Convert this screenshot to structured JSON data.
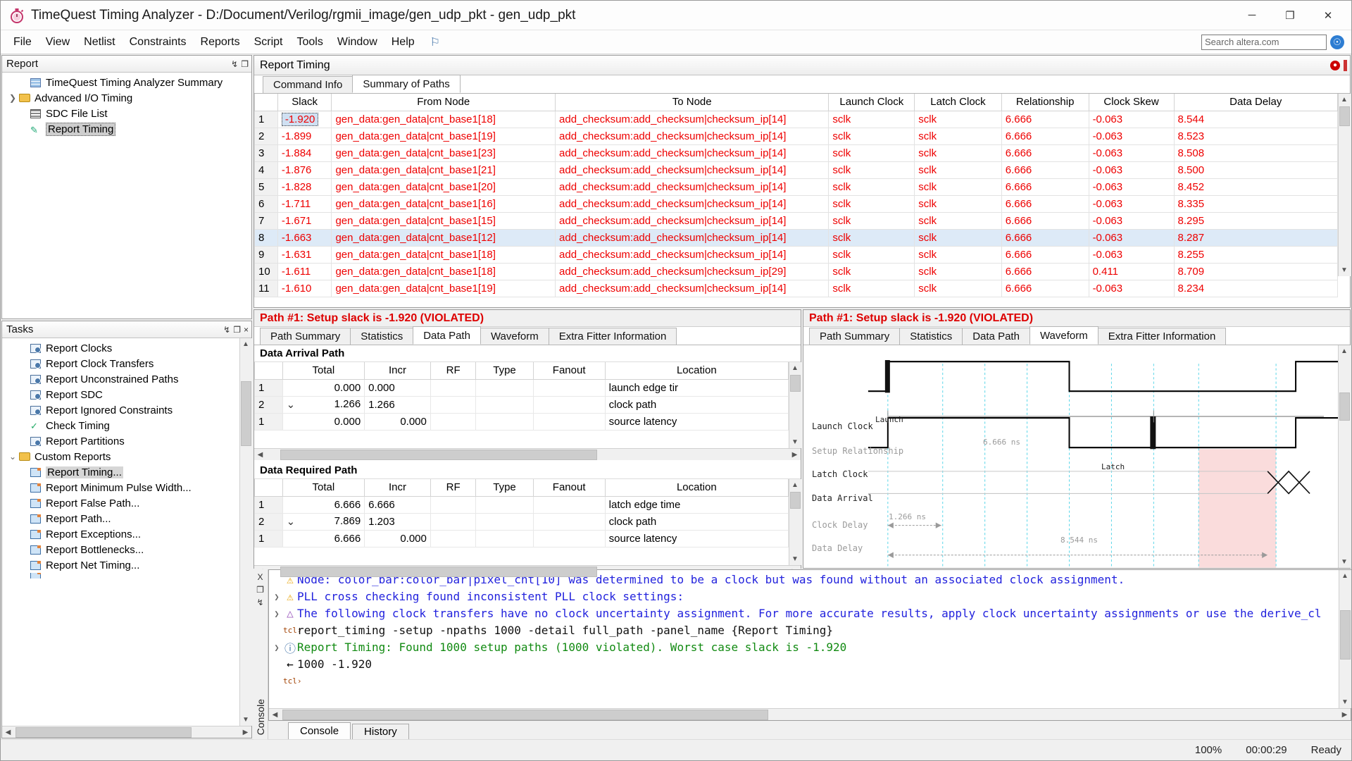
{
  "window": {
    "title": "TimeQuest Timing Analyzer - D:/Document/Verilog/rgmii_image/gen_udp_pkt - gen_udp_pkt",
    "app_icon": "stopwatch-icon",
    "minimize": "─",
    "maximize": "❐",
    "close": "✕"
  },
  "menubar": {
    "items": [
      "File",
      "View",
      "Netlist",
      "Constraints",
      "Reports",
      "Script",
      "Tools",
      "Window",
      "Help"
    ],
    "flag_icon": "flag-icon",
    "search_placeholder": "Search altera.com",
    "globe_icon": "globe-icon"
  },
  "report_panel": {
    "title": "Report",
    "pin": "↯",
    "float": "❐",
    "close": "×",
    "items": [
      {
        "label": "TimeQuest Timing Analyzer Summary",
        "icon": "table-icon",
        "twist": "",
        "indent": 1,
        "selected": false
      },
      {
        "label": "Advanced I/O Timing",
        "icon": "folder-icon",
        "twist": "❯",
        "indent": 0,
        "selected": false
      },
      {
        "label": "SDC File List",
        "icon": "table-icon",
        "twist": "",
        "indent": 1,
        "selected": false
      },
      {
        "label": "Report Timing",
        "icon": "pen-icon",
        "twist": "",
        "indent": 1,
        "selected": true
      }
    ]
  },
  "tasks_panel": {
    "title": "Tasks",
    "pin": "↯",
    "float": "❐",
    "close": "×",
    "items": [
      {
        "label": "Report Clocks",
        "icon": "report-icon",
        "twist": "",
        "indent": 1,
        "selected": false
      },
      {
        "label": "Report Clock Transfers",
        "icon": "report-icon",
        "twist": "",
        "indent": 1,
        "selected": false
      },
      {
        "label": "Report Unconstrained Paths",
        "icon": "report-icon",
        "twist": "",
        "indent": 1,
        "selected": false
      },
      {
        "label": "Report SDC",
        "icon": "report-icon",
        "twist": "",
        "indent": 1,
        "selected": false
      },
      {
        "label": "Report Ignored Constraints",
        "icon": "report-icon",
        "twist": "",
        "indent": 1,
        "selected": false
      },
      {
        "label": "Check Timing",
        "icon": "check-icon",
        "twist": "",
        "indent": 1,
        "selected": false
      },
      {
        "label": "Report Partitions",
        "icon": "report-icon",
        "twist": "",
        "indent": 1,
        "selected": false
      },
      {
        "label": "Custom Reports",
        "icon": "folder-open-icon",
        "twist": "⌄",
        "indent": 0,
        "selected": false
      },
      {
        "label": "Report Timing...",
        "icon": "window-icon",
        "twist": "",
        "indent": 2,
        "selected": true
      },
      {
        "label": "Report Minimum Pulse Width...",
        "icon": "window-icon",
        "twist": "",
        "indent": 2,
        "selected": false
      },
      {
        "label": "Report False Path...",
        "icon": "window-icon",
        "twist": "",
        "indent": 2,
        "selected": false
      },
      {
        "label": "Report Path...",
        "icon": "window-icon",
        "twist": "",
        "indent": 2,
        "selected": false
      },
      {
        "label": "Report Exceptions...",
        "icon": "window-icon",
        "twist": "",
        "indent": 2,
        "selected": false
      },
      {
        "label": "Report Bottlenecks...",
        "icon": "window-icon",
        "twist": "",
        "indent": 2,
        "selected": false
      },
      {
        "label": "Report Net Timing...",
        "icon": "window-icon",
        "twist": "",
        "indent": 2,
        "selected": false
      }
    ]
  },
  "report_timing": {
    "title": "Report Timing",
    "tabs": [
      {
        "label": "Command Info",
        "active": false
      },
      {
        "label": "Summary of Paths",
        "active": true
      }
    ],
    "columns": [
      "",
      "Slack",
      "From Node",
      "To Node",
      "Launch Clock",
      "Latch Clock",
      "Relationship",
      "Clock Skew",
      "Data Delay"
    ],
    "rows": [
      {
        "idx": "1",
        "slack": "-1.920",
        "from": "gen_data:gen_data|cnt_base1[18]",
        "to": "add_checksum:add_checksum|checksum_ip[14]",
        "launch": "sclk",
        "latch": "sclk",
        "rel": "6.666",
        "skew": "-0.063",
        "delay": "8.544",
        "selected": true,
        "highlight": false
      },
      {
        "idx": "2",
        "slack": "-1.899",
        "from": "gen_data:gen_data|cnt_base1[19]",
        "to": "add_checksum:add_checksum|checksum_ip[14]",
        "launch": "sclk",
        "latch": "sclk",
        "rel": "6.666",
        "skew": "-0.063",
        "delay": "8.523",
        "selected": false,
        "highlight": false
      },
      {
        "idx": "3",
        "slack": "-1.884",
        "from": "gen_data:gen_data|cnt_base1[23]",
        "to": "add_checksum:add_checksum|checksum_ip[14]",
        "launch": "sclk",
        "latch": "sclk",
        "rel": "6.666",
        "skew": "-0.063",
        "delay": "8.508",
        "selected": false,
        "highlight": false
      },
      {
        "idx": "4",
        "slack": "-1.876",
        "from": "gen_data:gen_data|cnt_base1[21]",
        "to": "add_checksum:add_checksum|checksum_ip[14]",
        "launch": "sclk",
        "latch": "sclk",
        "rel": "6.666",
        "skew": "-0.063",
        "delay": "8.500",
        "selected": false,
        "highlight": false
      },
      {
        "idx": "5",
        "slack": "-1.828",
        "from": "gen_data:gen_data|cnt_base1[20]",
        "to": "add_checksum:add_checksum|checksum_ip[14]",
        "launch": "sclk",
        "latch": "sclk",
        "rel": "6.666",
        "skew": "-0.063",
        "delay": "8.452",
        "selected": false,
        "highlight": false
      },
      {
        "idx": "6",
        "slack": "-1.711",
        "from": "gen_data:gen_data|cnt_base1[16]",
        "to": "add_checksum:add_checksum|checksum_ip[14]",
        "launch": "sclk",
        "latch": "sclk",
        "rel": "6.666",
        "skew": "-0.063",
        "delay": "8.335",
        "selected": false,
        "highlight": false
      },
      {
        "idx": "7",
        "slack": "-1.671",
        "from": "gen_data:gen_data|cnt_base1[15]",
        "to": "add_checksum:add_checksum|checksum_ip[14]",
        "launch": "sclk",
        "latch": "sclk",
        "rel": "6.666",
        "skew": "-0.063",
        "delay": "8.295",
        "selected": false,
        "highlight": false
      },
      {
        "idx": "8",
        "slack": "-1.663",
        "from": "gen_data:gen_data|cnt_base1[12]",
        "to": "add_checksum:add_checksum|checksum_ip[14]",
        "launch": "sclk",
        "latch": "sclk",
        "rel": "6.666",
        "skew": "-0.063",
        "delay": "8.287",
        "selected": false,
        "highlight": true
      },
      {
        "idx": "9",
        "slack": "-1.631",
        "from": "gen_data:gen_data|cnt_base1[18]",
        "to": "add_checksum:add_checksum|checksum_ip[14]",
        "launch": "sclk",
        "latch": "sclk",
        "rel": "6.666",
        "skew": "-0.063",
        "delay": "8.255",
        "selected": false,
        "highlight": false
      },
      {
        "idx": "10",
        "slack": "-1.611",
        "from": "gen_data:gen_data|cnt_base1[18]",
        "to": "add_checksum:add_checksum|checksum_ip[29]",
        "launch": "sclk",
        "latch": "sclk",
        "rel": "6.666",
        "skew": "0.411",
        "delay": "8.709",
        "selected": false,
        "highlight": false
      },
      {
        "idx": "11",
        "slack": "-1.610",
        "from": "gen_data:gen_data|cnt_base1[19]",
        "to": "add_checksum:add_checksum|checksum_ip[14]",
        "launch": "sclk",
        "latch": "sclk",
        "rel": "6.666",
        "skew": "-0.063",
        "delay": "8.234",
        "selected": false,
        "highlight": false
      }
    ]
  },
  "left_path_panel": {
    "title": "Path #1: Setup slack is -1.920 (VIOLATED)",
    "tabs": [
      {
        "label": "Path Summary",
        "active": false
      },
      {
        "label": "Statistics",
        "active": false
      },
      {
        "label": "Data Path",
        "active": true
      },
      {
        "label": "Waveform",
        "active": false
      },
      {
        "label": "Extra Fitter Information",
        "active": false
      }
    ],
    "arrival": {
      "section": "Data Arrival Path",
      "columns": [
        "",
        "Total",
        "Incr",
        "RF",
        "Type",
        "Fanout",
        "Location"
      ],
      "rows": [
        {
          "idx": "1",
          "total": "0.000",
          "incr": "0.000",
          "rf": "",
          "type": "",
          "fanout": "",
          "location": "launch edge tir",
          "twist": false,
          "indent": 0
        },
        {
          "idx": "2",
          "total": "1.266",
          "incr": "1.266",
          "rf": "",
          "type": "",
          "fanout": "",
          "location": "clock path",
          "twist": true,
          "indent": 0
        },
        {
          "idx": "1",
          "total": "0.000",
          "incr": "0.000",
          "rf": "",
          "type": "",
          "fanout": "",
          "location": "source latency",
          "twist": false,
          "indent": 1
        }
      ]
    },
    "required": {
      "section": "Data Required Path",
      "columns": [
        "",
        "Total",
        "Incr",
        "RF",
        "Type",
        "Fanout",
        "Location"
      ],
      "rows": [
        {
          "idx": "1",
          "total": "6.666",
          "incr": "6.666",
          "rf": "",
          "type": "",
          "fanout": "",
          "location": "latch edge time",
          "twist": false,
          "indent": 0
        },
        {
          "idx": "2",
          "total": "7.869",
          "incr": "1.203",
          "rf": "",
          "type": "",
          "fanout": "",
          "location": "clock path",
          "twist": true,
          "indent": 0
        },
        {
          "idx": "1",
          "total": "6.666",
          "incr": "0.000",
          "rf": "",
          "type": "",
          "fanout": "",
          "location": "source latency",
          "twist": false,
          "indent": 1
        }
      ]
    }
  },
  "right_path_panel": {
    "title": "Path #1: Setup slack is -1.920 (VIOLATED)",
    "tabs": [
      {
        "label": "Path Summary",
        "active": false
      },
      {
        "label": "Statistics",
        "active": false
      },
      {
        "label": "Data Path",
        "active": false
      },
      {
        "label": "Waveform",
        "active": true
      },
      {
        "label": "Extra Fitter Information",
        "active": false
      }
    ],
    "waveform": {
      "rows": [
        "Launch Clock",
        "Setup Relationship",
        "Latch Clock",
        "Data Arrival",
        "Clock Delay",
        "Data Delay"
      ],
      "markers": {
        "launch": "Launch",
        "latch": "Latch",
        "setup_relationship_value": "6.666 ns",
        "clock_delay_value": "1.266 ns",
        "data_delay_value": "8.544 ns"
      }
    }
  },
  "console": {
    "lines": [
      {
        "twist": "",
        "icon": "warning-icon",
        "icon_kind": "warn",
        "text": "Node: color_bar:color_bar|pixel_cnt[10] was determined to be a clock but was found without an associated clock assignment.",
        "color": "blue"
      },
      {
        "twist": "❯",
        "icon": "warning-icon",
        "icon_kind": "warn",
        "text": "PLL cross checking found inconsistent PLL clock settings:",
        "color": "blue"
      },
      {
        "twist": "❯",
        "icon": "warning-icon",
        "icon_kind": "warn2",
        "text": "The following clock transfers have no clock uncertainty assignment. For more accurate results, apply clock uncertainty assignments or use the derive_cl",
        "color": "blue"
      },
      {
        "twist": "",
        "icon": "tcl-icon",
        "icon_kind": "tcl",
        "text": "report_timing -setup -npaths 1000 -detail full_path -panel_name {Report Timing}",
        "color": "black"
      },
      {
        "twist": "❯",
        "icon": "info-icon",
        "icon_kind": "info",
        "text": "Report Timing: Found 1000 setup paths (1000 violated).  Worst case slack is -1.920",
        "color": "green"
      },
      {
        "twist": "",
        "icon": "return-icon",
        "icon_kind": "plain",
        "text": "1000 -1.920",
        "color": "black"
      },
      {
        "twist": "",
        "icon": "tcl-icon",
        "icon_kind": "tcl",
        "text": "",
        "color": "black"
      }
    ],
    "side_close": "X",
    "side_float": "❐",
    "side_pin": "↯",
    "label": "Console",
    "tabs": [
      {
        "label": "Console",
        "active": true
      },
      {
        "label": "History",
        "active": false
      }
    ]
  },
  "statusbar": {
    "zoom": "100%",
    "elapsed": "00:00:29",
    "ready": "Ready"
  }
}
